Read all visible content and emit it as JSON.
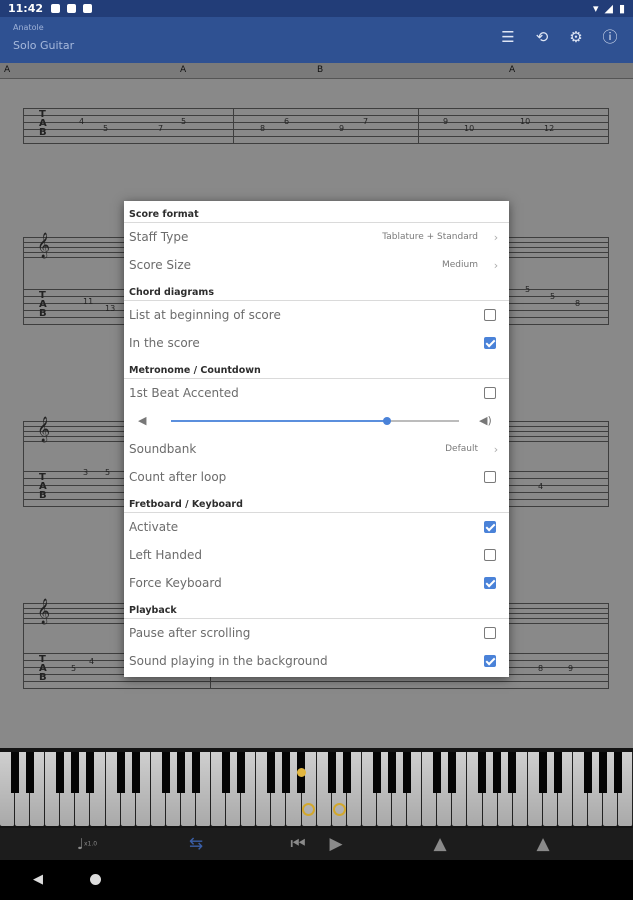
{
  "status": {
    "time": "11:42"
  },
  "app": {
    "artist": "Anatole",
    "song": "Solo Guitar"
  },
  "score": {
    "chord_labels": [
      "A",
      "A",
      "B",
      "A"
    ],
    "tab_letters": [
      "T",
      "A",
      "B"
    ],
    "system1_numbers": [
      "4",
      "5",
      "7",
      "5",
      "8",
      "6",
      "9",
      "7",
      "9",
      "10",
      "10",
      "12"
    ],
    "system2_numbers": [
      "11",
      "13",
      "5",
      "5",
      "8"
    ],
    "system3_numbers": [
      "3",
      "5",
      "4"
    ],
    "system4_numbers": [
      "5",
      "4",
      "8",
      "9"
    ]
  },
  "dialog": {
    "sections": {
      "score_format": "Score format",
      "chord_diagrams": "Chord diagrams",
      "metronome": "Metronome / Countdown",
      "fretboard": "Fretboard / Keyboard",
      "playback": "Playback"
    },
    "staff_type": {
      "label": "Staff Type",
      "value": "Tablature + Standard"
    },
    "score_size": {
      "label": "Score Size",
      "value": "Medium"
    },
    "list_beginning": {
      "label": "List at beginning of score",
      "checked": false
    },
    "in_score": {
      "label": "In the score",
      "checked": true
    },
    "first_beat": {
      "label": "1st Beat Accented",
      "checked": false
    },
    "volume": {
      "level": 0.75
    },
    "soundbank": {
      "label": "Soundbank",
      "value": "Default"
    },
    "count_after_loop": {
      "label": "Count after loop",
      "checked": false
    },
    "activate": {
      "label": "Activate",
      "checked": true
    },
    "left_handed": {
      "label": "Left Handed",
      "checked": false
    },
    "force_keyboard": {
      "label": "Force Keyboard",
      "checked": true
    },
    "pause_scrolling": {
      "label": "Pause after scrolling",
      "checked": false
    },
    "sound_background": {
      "label": "Sound playing in the background",
      "checked": true
    }
  },
  "transport": {
    "tempo": "x1.0"
  },
  "colors": {
    "appbar": "#2f5192",
    "accent": "#4a82d8"
  }
}
